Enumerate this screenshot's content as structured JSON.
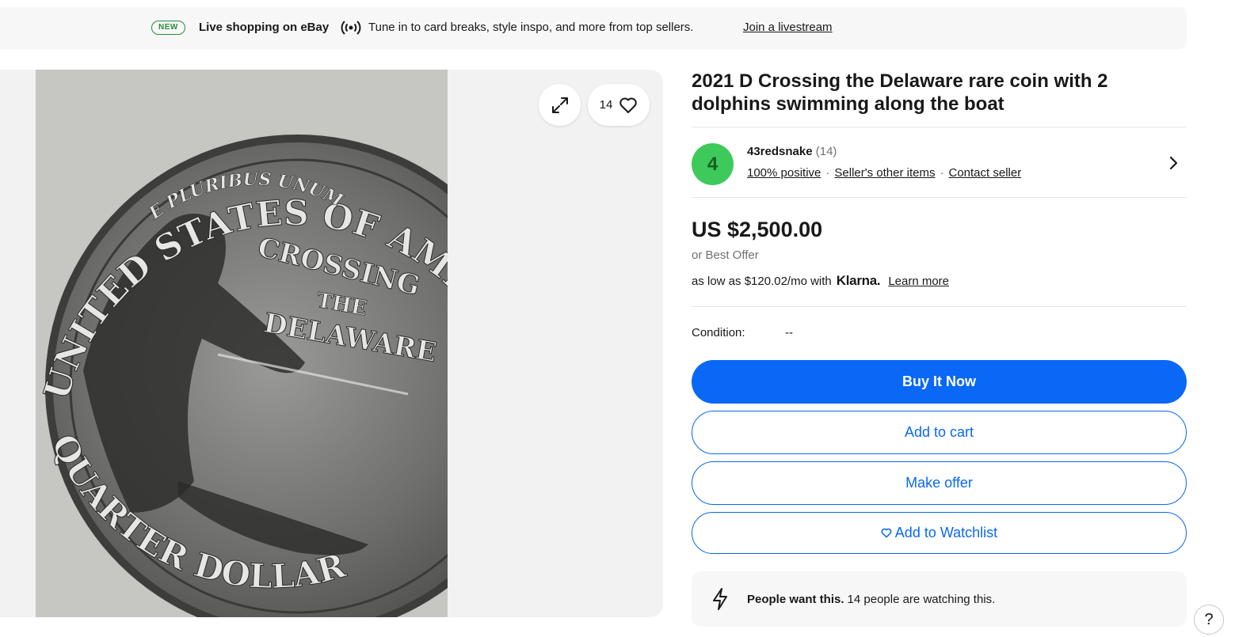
{
  "banner": {
    "badge": "NEW",
    "title": "Live shopping on eBay",
    "description": "Tune in to card breaks, style inspo, and more from top sellers.",
    "link": "Join a livestream"
  },
  "gallery": {
    "watch_count": "14",
    "coin_text": {
      "top": "UNITED STATES OF AMERICA",
      "motto": "E PLURIBUS UNUM",
      "line1": "CROSSING",
      "line2": "THE",
      "line3": "DELAWARE",
      "bottom": "QUARTER DOLLAR"
    }
  },
  "item": {
    "title": "2021 D Crossing the Delaware rare coin with 2 dolphins swimming along the boat",
    "price": "US $2,500.00",
    "best_offer": "or Best Offer",
    "klarna_prefix": "as low as $120.02/mo with",
    "klarna_logo": "Klarna.",
    "klarna_link": "Learn more",
    "condition_label": "Condition:",
    "condition_value": "--"
  },
  "seller": {
    "avatar_letter": "4",
    "name": "43redsnake",
    "feedback_count": "(14)",
    "positive": "100% positive",
    "other_items": "Seller's other items",
    "contact": "Contact seller"
  },
  "actions": {
    "buy_now": "Buy It Now",
    "add_to_cart": "Add to cart",
    "make_offer": "Make offer",
    "add_to_watchlist": "Add to Watchlist"
  },
  "demand": {
    "bold": "People want this.",
    "text": "14 people are watching this."
  },
  "help": "?",
  "colors": {
    "primary": "#0968f6",
    "avatar": "#3ec95b",
    "new_badge": "#2b8a3e"
  }
}
